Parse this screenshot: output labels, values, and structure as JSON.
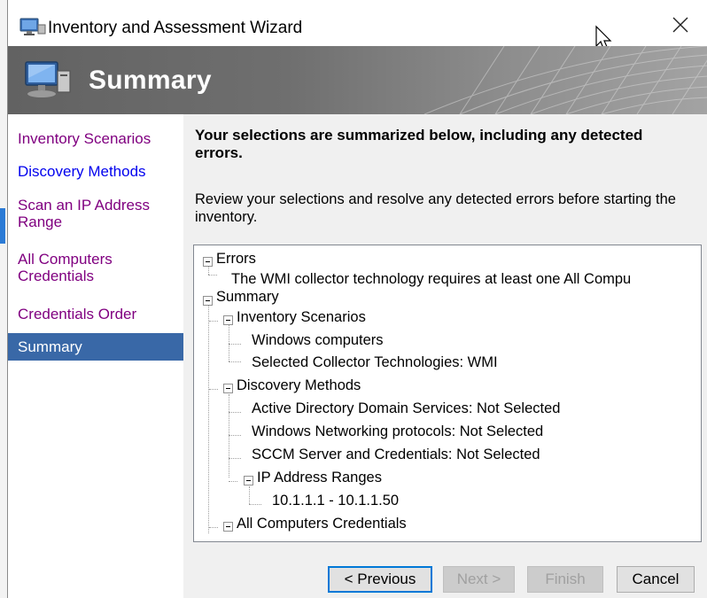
{
  "window": {
    "title": "Inventory and Assessment Wizard",
    "app_icon": "computer-monitor-icon",
    "close_icon": "close-icon"
  },
  "banner": {
    "title": "Summary",
    "icon": "computer-monitor-icon"
  },
  "sidebar": {
    "items": [
      {
        "label": "Inventory Scenarios",
        "state": "visited"
      },
      {
        "label": "Discovery Methods",
        "state": "link"
      },
      {
        "label": "Scan an IP Address Range",
        "state": "visited"
      },
      {
        "label": "All Computers Credentials",
        "state": "visited"
      },
      {
        "label": "Credentials Order",
        "state": "visited"
      },
      {
        "label": "Summary",
        "state": "active"
      }
    ]
  },
  "main": {
    "heading": "Your selections are summarized below, including any detected errors.",
    "description": "Review your selections and resolve any detected errors before starting the inventory."
  },
  "tree": {
    "errors": {
      "label": "Errors",
      "children": [
        "The WMI collector technology requires at least one All Compu"
      ]
    },
    "summary": {
      "label": "Summary",
      "inventory_scenarios": {
        "label": "Inventory Scenarios",
        "children": [
          "Windows computers",
          "Selected Collector Technologies: WMI"
        ]
      },
      "discovery_methods": {
        "label": "Discovery Methods",
        "children": [
          "Active Directory Domain Services: Not Selected",
          "Windows Networking protocols: Not Selected",
          "SCCM Server and Credentials: Not Selected"
        ],
        "ip_ranges": {
          "label": "IP Address Ranges",
          "children": [
            "10.1.1.1 - 10.1.1.50"
          ]
        }
      },
      "all_computers_credentials": {
        "label": "All Computers Credentials"
      }
    }
  },
  "buttons": {
    "previous": "< Previous",
    "next": "Next >",
    "finish": "Finish",
    "cancel": "Cancel"
  },
  "colors": {
    "active_nav": "#3968a7",
    "visited_link": "#800080",
    "link": "#0000ee",
    "default_button_border": "#0078d7"
  }
}
